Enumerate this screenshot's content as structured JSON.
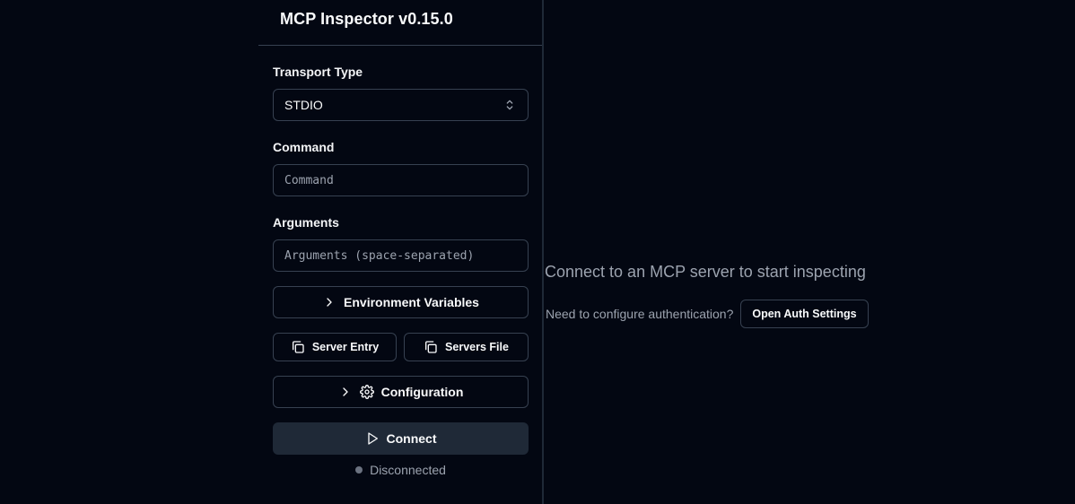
{
  "app": {
    "title": "MCP Inspector v0.15.0"
  },
  "sidebar": {
    "transport": {
      "label": "Transport Type",
      "value": "STDIO"
    },
    "command": {
      "label": "Command",
      "placeholder": "Command"
    },
    "arguments": {
      "label": "Arguments",
      "placeholder": "Arguments (space-separated)"
    },
    "env_button": "Environment Variables",
    "server_entry_button": "Server Entry",
    "servers_file_button": "Servers File",
    "config_button": "Configuration",
    "connect_button": "Connect",
    "status": {
      "text": "Disconnected",
      "color": "#6b7280"
    }
  },
  "main": {
    "empty_message": "Connect to an MCP server to start inspecting",
    "auth_prompt": "Need to configure authentication?",
    "auth_button": "Open Auth Settings"
  },
  "icons": {
    "select": "chevrons-up-down-icon",
    "env": "chevron-right-icon",
    "copy": "copy-icon",
    "config": "gear-icon",
    "connect": "play-icon"
  },
  "colors": {
    "background": "#030712",
    "border": "#374151",
    "connect_bg": "#1f2937",
    "muted": "#9ca3af"
  }
}
